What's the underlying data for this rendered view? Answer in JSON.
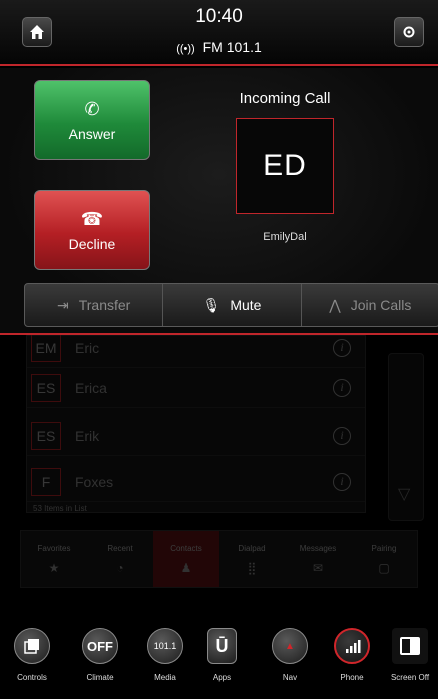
{
  "status": {
    "time": "10:40",
    "radio": "FM 101.1",
    "radio_icon": "antenna-icon"
  },
  "call": {
    "header": "Incoming Call",
    "initials": "ED",
    "caller": "EmilyDal",
    "answer_label": "Answer",
    "decline_label": "Decline"
  },
  "actions": [
    {
      "label": "Transfer",
      "icon": "transfer-icon"
    },
    {
      "label": "Mute",
      "icon": "mute-icon"
    },
    {
      "label": "Join Calls",
      "icon": "join-calls-icon"
    }
  ],
  "contacts": {
    "rows": [
      {
        "initials": "EM",
        "name": "Eric"
      },
      {
        "initials": "ES",
        "name": "Erica"
      },
      {
        "initials": "ES",
        "name": "Erik"
      },
      {
        "initials": "F",
        "name": "Foxes"
      }
    ],
    "count_text": "53 Items in List"
  },
  "tabs": [
    {
      "label": "Favorites",
      "icon": "star-icon"
    },
    {
      "label": "Recent",
      "icon": "clock-icon"
    },
    {
      "label": "Contacts",
      "icon": "person-icon",
      "active": true
    },
    {
      "label": "Dialpad",
      "icon": "dialpad-icon"
    },
    {
      "label": "Messages",
      "icon": "message-icon"
    },
    {
      "label": "Pairing",
      "icon": "pairing-icon"
    }
  ],
  "dock": {
    "controls": "Controls",
    "climate": "Climate",
    "climate_badge": "OFF",
    "media": "Media",
    "media_badge": "101.1",
    "apps": "Apps",
    "nav": "Nav",
    "phone": "Phone",
    "screen_off": "Screen Off"
  },
  "colors": {
    "accent": "#c0262b",
    "answer": "#1f8a3a",
    "decline": "#b41f24"
  }
}
